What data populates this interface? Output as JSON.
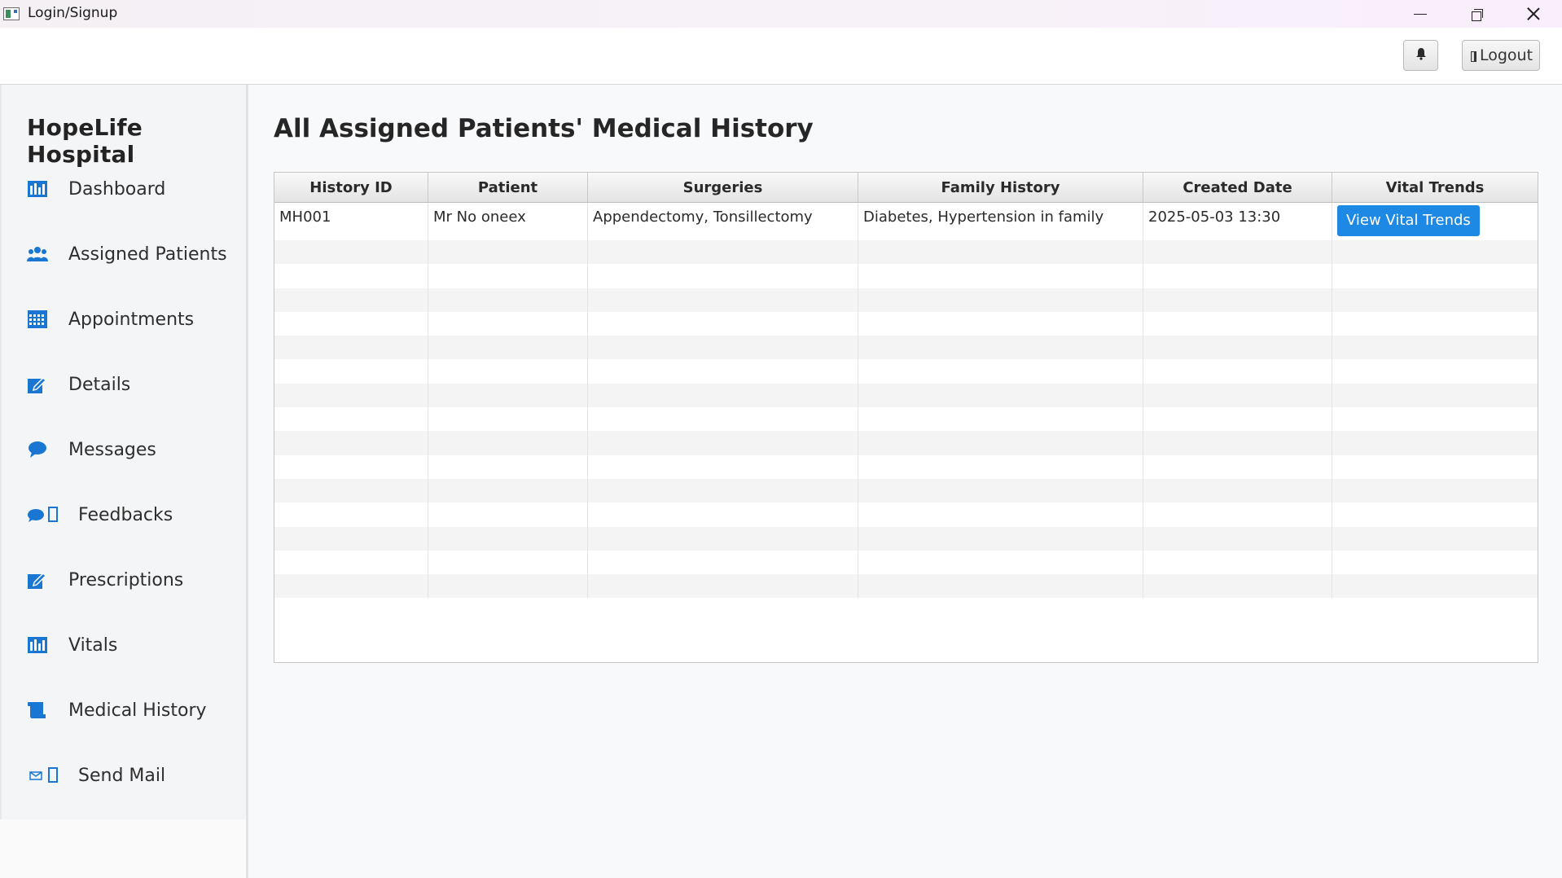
{
  "window": {
    "title": "Login/Signup"
  },
  "topbar": {
    "logout_label": "Logout"
  },
  "sidebar": {
    "hospital_name": "HopeLife Hospital",
    "items": [
      {
        "label": "Dashboard",
        "icon": "bar-chart-icon"
      },
      {
        "label": "Assigned Patients",
        "icon": "users-icon"
      },
      {
        "label": "Appointments",
        "icon": "calendar-icon"
      },
      {
        "label": "Details",
        "icon": "edit-icon"
      },
      {
        "label": "Messages",
        "icon": "chat-bubble-icon"
      },
      {
        "label": "Feedbacks",
        "icon": "feedback-icon"
      },
      {
        "label": "Prescriptions",
        "icon": "edit-icon"
      },
      {
        "label": "Vitals",
        "icon": "bar-chart-icon"
      },
      {
        "label": "Medical History",
        "icon": "scroll-icon"
      },
      {
        "label": "Send Mail",
        "icon": "mail-icon"
      }
    ]
  },
  "main": {
    "page_title": "All Assigned Patients' Medical History",
    "table": {
      "columns": [
        "History ID",
        "Patient",
        "Surgeries",
        "Family History",
        "Created Date",
        "Vital Trends"
      ],
      "rows": [
        {
          "history_id": "MH001",
          "patient": "Mr No oneex",
          "surgeries": "Appendectomy, Tonsillectomy",
          "family_history": "Diabetes, Hypertension in family",
          "created_date": "2025-05-03 13:30",
          "action_label": "View Vital Trends"
        }
      ]
    }
  },
  "colors": {
    "accent": "#1e88e5",
    "icon_blue": "#1976d2"
  }
}
